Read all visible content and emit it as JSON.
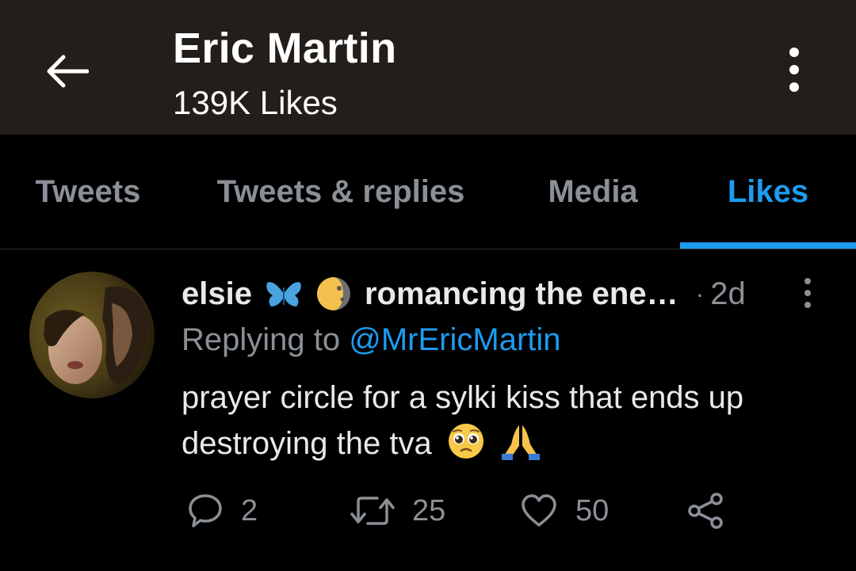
{
  "header": {
    "title": "Eric Martin",
    "subtitle": "139K Likes",
    "back_icon": "arrow-left-icon",
    "more_icon": "more-vertical-icon",
    "background": "#231e19"
  },
  "tabs": [
    {
      "label": "Tweets",
      "active": false
    },
    {
      "label": "Tweets & replies",
      "active": false
    },
    {
      "label": "Media",
      "active": false
    },
    {
      "label": "Likes",
      "active": true
    }
  ],
  "accent_color": "#1d9bf0",
  "tweet": {
    "author_name": "elsie",
    "author_name_emojis": [
      "butterfly-icon",
      "moon-icon"
    ],
    "author_name_tail": "romancing the ene…",
    "separator": "·",
    "timestamp": "2d",
    "reply_prefix": "Replying to",
    "reply_handle": "@MrEricMartin",
    "text": "prayer circle for a sylki kiss that ends up destroying the tva",
    "text_emojis": [
      "pleading-face-icon",
      "folded-hands-icon"
    ],
    "actions": {
      "reply_count": "2",
      "retweet_count": "25",
      "like_count": "50"
    }
  }
}
